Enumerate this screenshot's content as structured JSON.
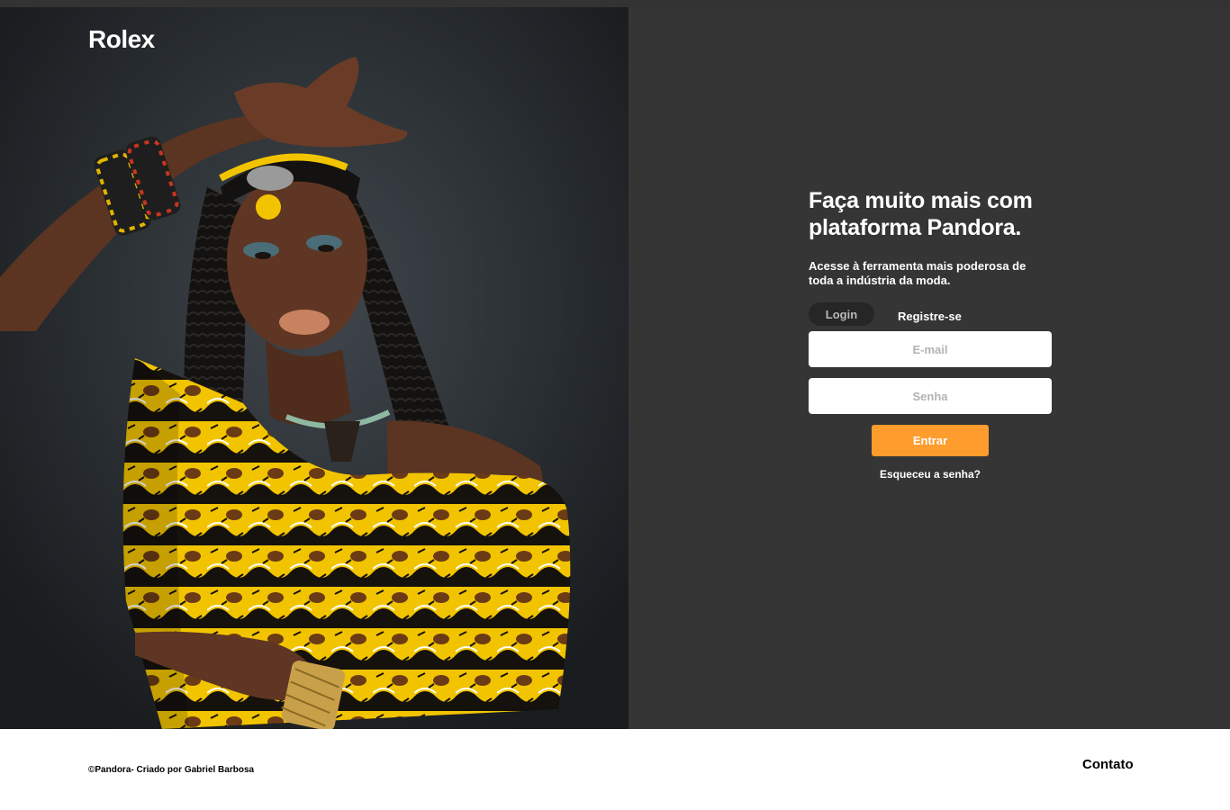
{
  "brand": {
    "name": "Rolex"
  },
  "hero": {
    "headline": "Faça muito mais com plataforma Pandora.",
    "subheadline": "Acesse à ferramenta mais poderosa de toda a indústria da moda."
  },
  "auth": {
    "tabs": {
      "login": "Login",
      "register": "Registre-se"
    },
    "email_placeholder": "E-mail",
    "password_placeholder": "Senha",
    "submit_label": "Entrar",
    "forgot_label": "Esqueceu a senha?"
  },
  "footer": {
    "copyright": "©Pandora- Criado por Gabriel Barbosa",
    "contact": "Contato"
  },
  "colors": {
    "panel_bg": "#353535",
    "accent": "#ff9c2e",
    "active_tab_bg": "#262626"
  }
}
